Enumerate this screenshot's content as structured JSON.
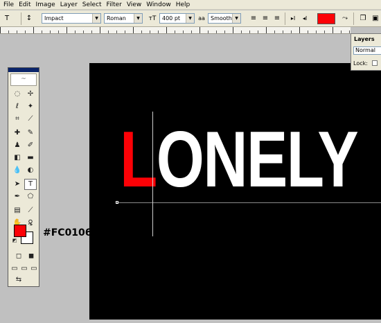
{
  "menu": [
    "File",
    "Edit",
    "Image",
    "Layer",
    "Select",
    "Filter",
    "View",
    "Window",
    "Help"
  ],
  "options": {
    "font_family": "Impact",
    "font_style": "Roman",
    "font_size": "400 pt",
    "antialias": "Smooth",
    "text_color": "#fc0106"
  },
  "canvas": {
    "first_letter": "L",
    "rest_text": "ONELY",
    "first_letter_color": "#fc0106",
    "text_color": "#ffffff",
    "background": "#000000"
  },
  "annotation": {
    "hex": "#FC0106"
  },
  "layers": {
    "tab": "Layers",
    "blend_mode": "Normal",
    "lock_label": "Lock:"
  },
  "colors": {
    "foreground": "#fc0106",
    "background": "#ffffff"
  }
}
